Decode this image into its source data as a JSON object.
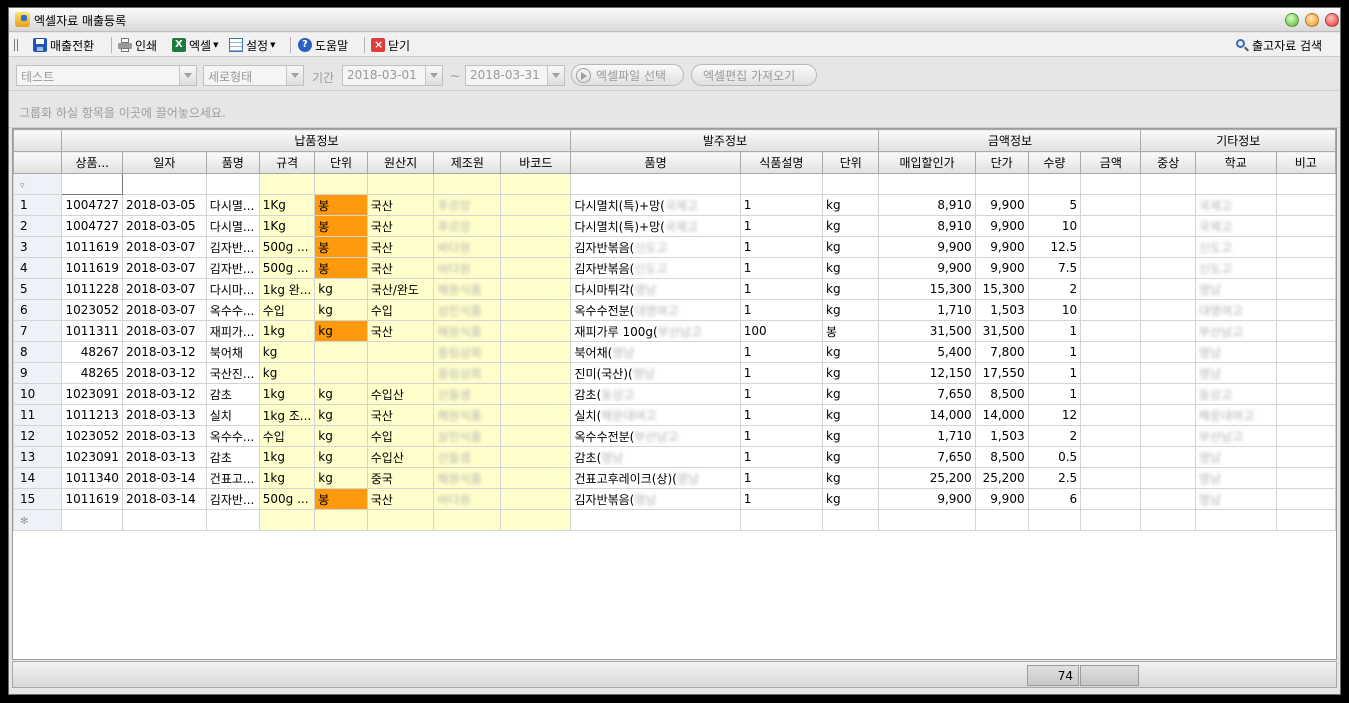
{
  "window": {
    "title": "엑셀자료 매출등록"
  },
  "toolbar": {
    "convert_label": "매출전환",
    "print_label": "인쇄",
    "excel_label": "엑셀",
    "settings_label": "설정",
    "help_label": "도움말",
    "close_label": "닫기",
    "search_label": "출고자료 검색"
  },
  "filters": {
    "source_value": "테스트",
    "layout_value": "세로형태",
    "period_label": "기간",
    "date_from": "2018-03-01",
    "tilde": "~",
    "date_to": "2018-03-31",
    "select_file_label": "엑셀파일 선택",
    "import_label": "엑셀편집 가져오기"
  },
  "group_panel": {
    "hint": "그룹화 하실 항목을 이곳에 끌어놓으세요."
  },
  "grid": {
    "bands": [
      "납품정보",
      "발주정보",
      "금액정보",
      "기타정보"
    ],
    "columns": [
      "상품...",
      "일자",
      "품명",
      "규격",
      "단위",
      "원산지",
      "제조원",
      "바코드",
      "품명",
      "식품설명",
      "단위",
      "매입할인가",
      "단가",
      "수량",
      "금액",
      "중상",
      "학교",
      "비고"
    ],
    "filter_icon": "▿",
    "new_row_icon": "✻",
    "rows": [
      {
        "no": "1",
        "code": "1004727",
        "date": "2018-03-05",
        "name": "다시멸...",
        "spec": "1Kg",
        "unit": "봉",
        "origin": "국산",
        "maker": "푸르앙",
        "barcode": "",
        "order_name": "다시멸치(특)+망(",
        "order_blur": "국제고",
        "food_desc": "1",
        "order_unit": "kg",
        "disc_price": "8,910",
        "unit_price": "9,900",
        "qty": "5",
        "amount": "",
        "jungsang": "",
        "school": "국제고",
        "note": ""
      },
      {
        "no": "2",
        "code": "1004727",
        "date": "2018-03-05",
        "name": "다시멸...",
        "spec": "1Kg",
        "unit": "봉",
        "origin": "국산",
        "maker": "푸르앙",
        "barcode": "",
        "order_name": "다시멸치(특)+망(",
        "order_blur": "국제고",
        "food_desc": "1",
        "order_unit": "kg",
        "disc_price": "8,910",
        "unit_price": "9,900",
        "qty": "10",
        "amount": "",
        "jungsang": "",
        "school": "국제고",
        "note": ""
      },
      {
        "no": "3",
        "code": "1011619",
        "date": "2018-03-07",
        "name": "김자반...",
        "spec": "500g ...",
        "unit": "봉",
        "origin": "국산",
        "maker": "바다원",
        "barcode": "",
        "order_name": "김자반볶음(",
        "order_blur": "신도고",
        "food_desc": "1",
        "order_unit": "kg",
        "disc_price": "9,900",
        "unit_price": "9,900",
        "qty": "12.5",
        "amount": "",
        "jungsang": "",
        "school": "신도고",
        "note": ""
      },
      {
        "no": "4",
        "code": "1011619",
        "date": "2018-03-07",
        "name": "김자반...",
        "spec": "500g ...",
        "unit": "봉",
        "origin": "국산",
        "maker": "바다원",
        "barcode": "",
        "order_name": "김자반볶음(",
        "order_blur": "신도고",
        "food_desc": "1",
        "order_unit": "kg",
        "disc_price": "9,900",
        "unit_price": "9,900",
        "qty": "7.5",
        "amount": "",
        "jungsang": "",
        "school": "신도고",
        "note": ""
      },
      {
        "no": "5",
        "code": "1011228",
        "date": "2018-03-07",
        "name": "다시마...",
        "spec": "1kg 완...",
        "unit": "kg",
        "origin": "국산/완도",
        "maker": "해원식품",
        "barcode": "",
        "order_name": "다시마튀각(",
        "order_blur": "영남",
        "food_desc": "1",
        "order_unit": "kg",
        "disc_price": "15,300",
        "unit_price": "15,300",
        "qty": "2",
        "amount": "",
        "jungsang": "",
        "school": "영남",
        "note": ""
      },
      {
        "no": "6",
        "code": "1023052",
        "date": "2018-03-07",
        "name": "옥수수...",
        "spec": "수입",
        "unit": "kg",
        "origin": "수입",
        "maker": "삼진식품",
        "barcode": "",
        "order_name": "옥수수전분(",
        "order_blur": "대명여고",
        "food_desc": "1",
        "order_unit": "kg",
        "disc_price": "1,710",
        "unit_price": "1,503",
        "qty": "10",
        "amount": "",
        "jungsang": "",
        "school": "대명여고",
        "note": ""
      },
      {
        "no": "7",
        "code": "1011311",
        "date": "2018-03-07",
        "name": "재피가...",
        "spec": "1kg",
        "unit": "kg",
        "origin": "국산",
        "maker": "해원식품",
        "barcode": "",
        "order_name": "재피가루 100g(",
        "order_blur": "부산남고",
        "food_desc": "100",
        "order_unit": "봉",
        "disc_price": "31,500",
        "unit_price": "31,500",
        "qty": "1",
        "amount": "",
        "jungsang": "",
        "school": "부산남고",
        "note": ""
      },
      {
        "no": "8",
        "code": "48267",
        "date": "2018-03-12",
        "name": "북어채",
        "spec": "kg",
        "unit": "",
        "origin": "",
        "maker": "용림상회",
        "barcode": "",
        "order_name": "북어채(",
        "order_blur": "영남",
        "food_desc": "1",
        "order_unit": "kg",
        "disc_price": "5,400",
        "unit_price": "7,800",
        "qty": "1",
        "amount": "",
        "jungsang": "",
        "school": "영남",
        "note": ""
      },
      {
        "no": "9",
        "code": "48265",
        "date": "2018-03-12",
        "name": "국산진...",
        "spec": "kg",
        "unit": "",
        "origin": "",
        "maker": "용림상회",
        "barcode": "",
        "order_name": "진미(국산)(",
        "order_blur": "영남",
        "food_desc": "1",
        "order_unit": "kg",
        "disc_price": "12,150",
        "unit_price": "17,550",
        "qty": "1",
        "amount": "",
        "jungsang": "",
        "school": "영남",
        "note": ""
      },
      {
        "no": "10",
        "code": "1023091",
        "date": "2018-03-12",
        "name": "감초",
        "spec": "1kg",
        "unit": "kg",
        "origin": "수입산",
        "maker": "산들샘",
        "barcode": "",
        "order_name": "감초(",
        "order_blur": "동상고",
        "food_desc": "1",
        "order_unit": "kg",
        "disc_price": "7,650",
        "unit_price": "8,500",
        "qty": "1",
        "amount": "",
        "jungsang": "",
        "school": "동상고",
        "note": ""
      },
      {
        "no": "11",
        "code": "1011213",
        "date": "2018-03-13",
        "name": "실치",
        "spec": "1kg 조...",
        "unit": "kg",
        "origin": "국산",
        "maker": "해원식품",
        "barcode": "",
        "order_name": "실치(",
        "order_blur": "해운대여고",
        "food_desc": "1",
        "order_unit": "kg",
        "disc_price": "14,000",
        "unit_price": "14,000",
        "qty": "12",
        "amount": "",
        "jungsang": "",
        "school": "해운대여고",
        "note": ""
      },
      {
        "no": "12",
        "code": "1023052",
        "date": "2018-03-13",
        "name": "옥수수...",
        "spec": "수입",
        "unit": "kg",
        "origin": "수입",
        "maker": "삼진식품",
        "barcode": "",
        "order_name": "옥수수전분(",
        "order_blur": "부산남고",
        "food_desc": "1",
        "order_unit": "kg",
        "disc_price": "1,710",
        "unit_price": "1,503",
        "qty": "2",
        "amount": "",
        "jungsang": "",
        "school": "부산남고",
        "note": ""
      },
      {
        "no": "13",
        "code": "1023091",
        "date": "2018-03-13",
        "name": "감초",
        "spec": "1kg",
        "unit": "kg",
        "origin": "수입산",
        "maker": "산들샘",
        "barcode": "",
        "order_name": "감초(",
        "order_blur": "영남",
        "food_desc": "1",
        "order_unit": "kg",
        "disc_price": "7,650",
        "unit_price": "8,500",
        "qty": "0.5",
        "amount": "",
        "jungsang": "",
        "school": "영남",
        "note": ""
      },
      {
        "no": "14",
        "code": "1011340",
        "date": "2018-03-14",
        "name": "건표고...",
        "spec": "1kg",
        "unit": "kg",
        "origin": "중국",
        "maker": "해원식품",
        "barcode": "",
        "order_name": "건표고후레이크(상)(",
        "order_blur": "영남",
        "food_desc": "1",
        "order_unit": "kg",
        "disc_price": "25,200",
        "unit_price": "25,200",
        "qty": "2.5",
        "amount": "",
        "jungsang": "",
        "school": "영남",
        "note": ""
      },
      {
        "no": "15",
        "code": "1011619",
        "date": "2018-03-14",
        "name": "김자반...",
        "spec": "500g ...",
        "unit": "봉",
        "origin": "국산",
        "maker": "바다원",
        "barcode": "",
        "order_name": "김자반볶음(",
        "order_blur": "영남",
        "food_desc": "1",
        "order_unit": "kg",
        "disc_price": "9,900",
        "unit_price": "9,900",
        "qty": "6",
        "amount": "",
        "jungsang": "",
        "school": "영남",
        "note": ""
      }
    ]
  },
  "status": {
    "count": "74",
    "extra": ""
  },
  "colors": {
    "highlight_orange": "#ff9a0d",
    "highlight_yellow": "#ffffcc",
    "row_header": "#eef1f8"
  }
}
